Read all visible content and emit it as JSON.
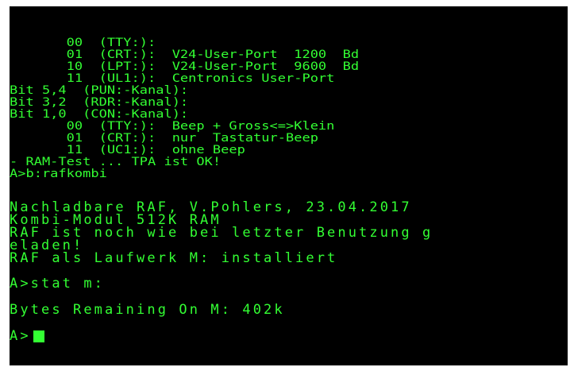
{
  "terminal": {
    "foreground": "#33ff33",
    "background": "#000000",
    "block_a": [
      "       00  (TTY:):",
      "       01  (CRT:):  V24-User-Port  1200  Bd",
      "       10  (LPT:):  V24-User-Port  9600  Bd",
      "       11  (UL1:):  Centronics User-Port",
      "Bit 5,4  (PUN:-Kanal):",
      "Bit 3,2  (RDR:-Kanal):",
      "Bit 1,0  (CON:-Kanal):",
      "       00  (TTY:):  Beep + Gross<=>Klein",
      "       01  (CRT:):  nur  Tastatur-Beep",
      "       11  (UC1:):  ohne Beep",
      "- RAM-Test ... TPA ist OK!",
      "A>b:rafkombi"
    ],
    "block_b": [
      "Nachladbare RAF, V.Pohlers, 23.04.2017",
      "Kombi-Modul 512K RAM",
      "RAF ist noch wie bei letzter Benutzung g",
      "eladen!",
      "RAF als Laufwerk M: installiert"
    ],
    "stat_command": "A>stat m:",
    "stat_result": "Bytes Remaining On M: 402k",
    "prompt": "A>"
  }
}
